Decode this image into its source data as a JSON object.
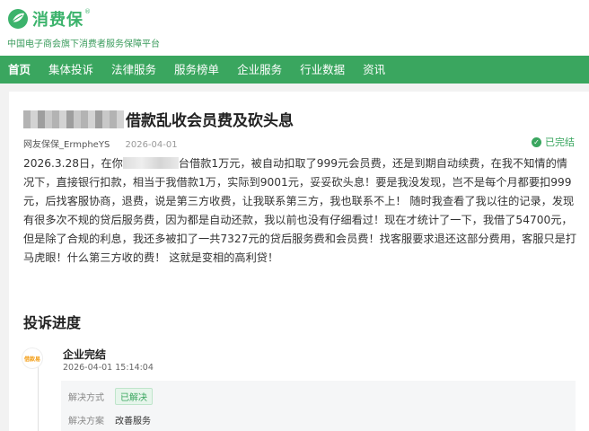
{
  "brand": {
    "name": "消费保",
    "reg_mark": "®",
    "slogan": "中国电子商会旗下消费者服务保障平台",
    "color": "#3cb36c"
  },
  "nav": {
    "items": [
      "首页",
      "集体投诉",
      "法律服务",
      "服务榜单",
      "企业服务",
      "行业数据",
      "资讯"
    ],
    "bg_color": "#3aa65f"
  },
  "complaint": {
    "title": "借款乱收会员费及砍头息",
    "author": "网友保保_ErmpheYS",
    "date": "2026-04-01",
    "status": "已完结",
    "body_before_mask": "2026.3.28日，在你",
    "body_after_mask": "台借款1万元，被自动扣取了999元会员费，还是到期自动续费，在我不知情的情况下，直接银行扣款，相当于我借款1万，实际到9001元，妥妥砍头息！要是我没发现，岂不是每个月都要扣999元，后找客服协商，退费，说是第三方收费，让我联系第三方，我也联系不上！ 随时我查看了我以往的记录，发现有很多次不规的贷后服务费，因为都是自动还款，我以前也没有仔细看过！现在才统计了一下，我借了54700元，但是除了合规的利息，我还多被扣了一共7327元的贷后服务费和会员费！找客服要求退还这部分费用，客服只是打马虎眼！什么第三方收的费！ 这就是变相的高利贷！"
  },
  "progress": {
    "section_title": "投诉进度",
    "event_title": "企业完结",
    "event_time": "2026-04-01 15:14:04",
    "avatar_text": "借款易",
    "resolution_label": "解决方式",
    "resolution_value": "已解决",
    "plan_label": "解决方案",
    "plan_value": "改善服务"
  }
}
